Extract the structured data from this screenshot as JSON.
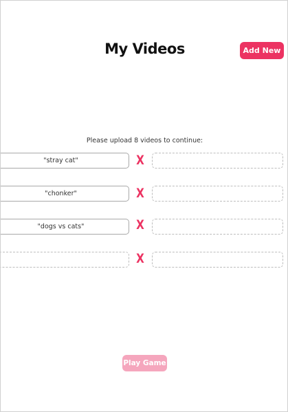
{
  "header": {
    "title": "My Videos",
    "add_new_label": "Add New"
  },
  "instructions": "Please upload 8 videos to continue:",
  "matchups": [
    {
      "left": "\"stray cat\"",
      "separator": "X",
      "right": ""
    },
    {
      "left": "\"chonker\"",
      "separator": "X",
      "right": ""
    },
    {
      "left": "\"dogs vs cats\"",
      "separator": "X",
      "right": ""
    },
    {
      "left": "",
      "separator": "X",
      "right": ""
    }
  ],
  "footer": {
    "play_label": "Play Game"
  },
  "colors": {
    "accent": "#ec3362",
    "accent_disabled": "#f5a6bd"
  }
}
